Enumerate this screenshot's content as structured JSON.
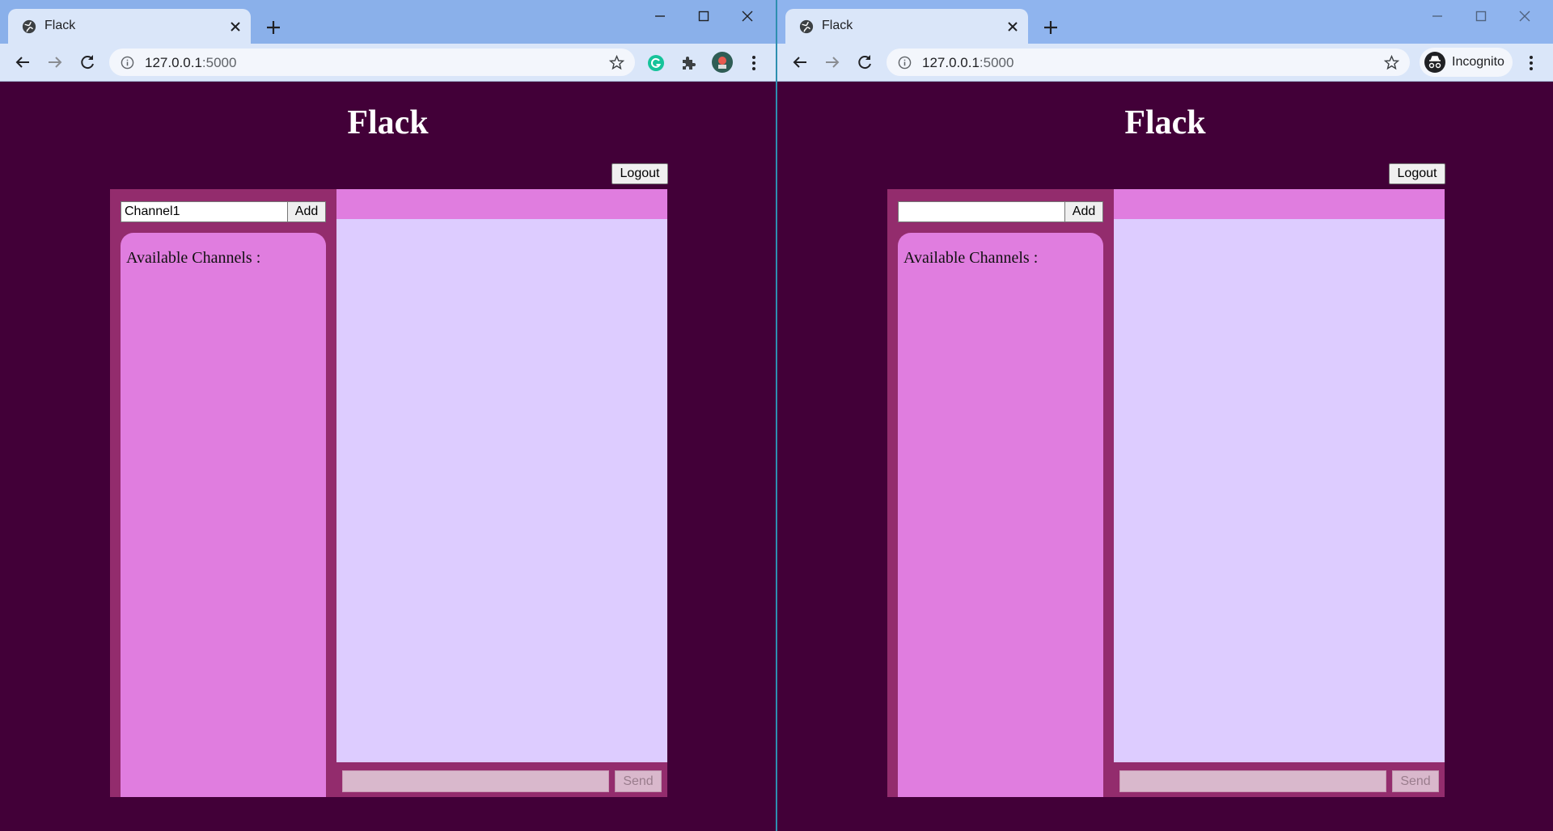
{
  "windows": [
    {
      "tab_title": "Flack",
      "url_host": "127.0.0.1",
      "url_port": ":5000",
      "incognito_label": "",
      "page": {
        "title": "Flack",
        "logout_label": "Logout",
        "channel_input_value": "Channel1",
        "add_label": "Add",
        "channels_heading": "Available Channels :",
        "send_label": "Send"
      }
    },
    {
      "tab_title": "Flack",
      "url_host": "127.0.0.1",
      "url_port": ":5000",
      "incognito_label": "Incognito",
      "page": {
        "title": "Flack",
        "logout_label": "Logout",
        "channel_input_value": "",
        "add_label": "Add",
        "channels_heading": "Available Channels :",
        "send_label": "Send"
      }
    }
  ],
  "colors": {
    "page_bg": "#420038",
    "sidebar_bg": "#932c6d",
    "channels_panel": "#e07ddf",
    "messages_bg": "#ddccff",
    "send_disabled": "#d9b8cc"
  },
  "icons": {
    "favicon": "globe-icon",
    "extensions": [
      "grammarly-icon",
      "puzzle-icon",
      "avatar"
    ]
  }
}
